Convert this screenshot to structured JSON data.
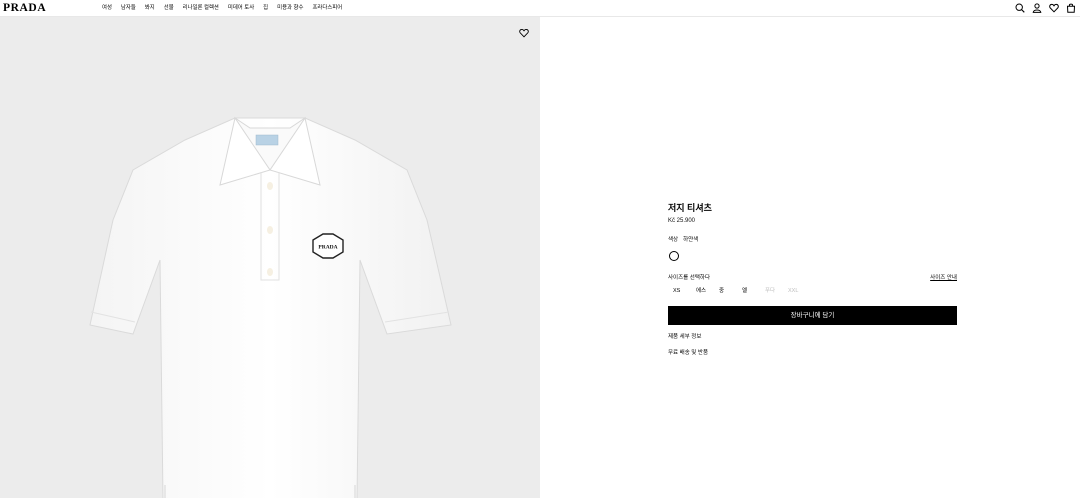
{
  "header": {
    "logo": "PRADA",
    "nav": [
      "여성",
      "남자들",
      "봐지",
      "선물",
      "리나일론 컬렉션",
      "미데어 토사",
      "집",
      "미용과 향수",
      "프라다스피어"
    ],
    "icons": [
      "search-icon",
      "account-icon",
      "wishlist-icon",
      "bag-icon"
    ]
  },
  "product": {
    "title": "저지 티셔츠",
    "price": "Kč 25.900",
    "color_label": "색상",
    "color_value": "하얀색",
    "size_label": "사이즈를 선택하다",
    "size_guide": "사이즈 안내",
    "sizes": [
      {
        "label": "XS",
        "available": true
      },
      {
        "label": "에스",
        "available": true
      },
      {
        "label": "중",
        "available": true
      },
      {
        "label": "엘",
        "available": true
      },
      {
        "label": "푸다",
        "available": false
      },
      {
        "label": "XXL",
        "available": false
      }
    ],
    "add_to_cart": "장바구니에 담기",
    "details_link": "제품 세부 정보",
    "shipping_link": "무료 배송 및 반품",
    "image_badge": "PRADA",
    "colors": {
      "accent": "#000000",
      "panel_bg": "#ececec",
      "disabled": "#bdbdbd"
    }
  }
}
